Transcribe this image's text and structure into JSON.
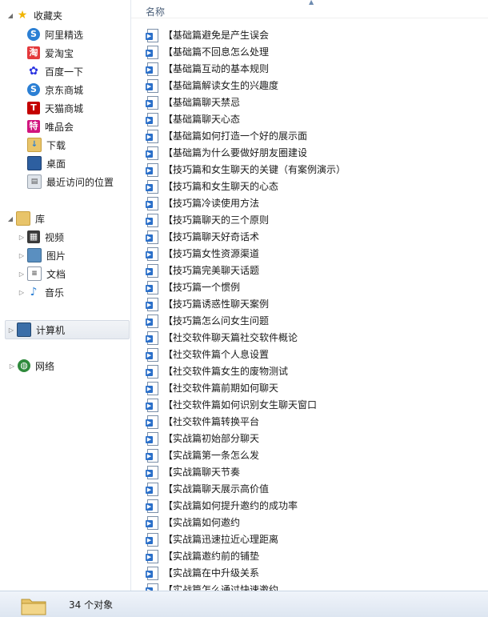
{
  "sidebar": {
    "favorites": {
      "label": "收藏夹",
      "items": [
        {
          "label": "阿里精选",
          "icon": "ali-icon"
        },
        {
          "label": "爱淘宝",
          "icon": "taobao-icon"
        },
        {
          "label": "百度一下",
          "icon": "baidu-icon"
        },
        {
          "label": "京东商城",
          "icon": "jd-icon"
        },
        {
          "label": "天猫商城",
          "icon": "tmall-icon"
        },
        {
          "label": "唯品会",
          "icon": "vip-icon"
        },
        {
          "label": "下载",
          "icon": "download-folder-icon"
        },
        {
          "label": "桌面",
          "icon": "desktop-icon"
        },
        {
          "label": "最近访问的位置",
          "icon": "recent-places-icon"
        }
      ]
    },
    "libraries": {
      "label": "库",
      "items": [
        {
          "label": "视频",
          "icon": "video-library-icon"
        },
        {
          "label": "图片",
          "icon": "pictures-library-icon"
        },
        {
          "label": "文档",
          "icon": "documents-library-icon"
        },
        {
          "label": "音乐",
          "icon": "music-library-icon"
        }
      ]
    },
    "computer": {
      "label": "计算机"
    },
    "network": {
      "label": "网络"
    }
  },
  "content": {
    "column_header": "名称",
    "files": [
      "【基础篇避免是产生误会",
      "【基础篇不回息怎么处理",
      "【基础篇互动的基本规则",
      "【基础篇解读女生的兴趣度",
      "【基础篇聊天禁忌",
      "【基础篇聊天心态",
      "【基础篇如何打造一个好的展示面",
      "【基础篇为什么要做好朋友圈建设",
      "【技巧篇和女生聊天的关键（有案例演示）",
      "【技巧篇和女生聊天的心态",
      "【技巧篇冷读使用方法",
      "【技巧篇聊天的三个原则",
      "【技巧篇聊天好奇话术",
      "【技巧篇女性资源渠道",
      "【技巧篇完美聊天话题",
      "【技巧篇一个惯例",
      "【技巧篇诱惑性聊天案例",
      "【技巧篇怎么问女生问题",
      "【社交软件聊天篇社交软件概论",
      "【社交软件篇个人息设置",
      "【社交软件篇女生的废物测试",
      "【社交软件篇前期如何聊天",
      "【社交软件篇如何识别女生聊天窗口",
      "【社交软件篇转换平台",
      "【实战篇初始部分聊天",
      "【实战篇第一条怎么发",
      "【实战篇聊天节奏",
      "【实战篇聊天展示高价值",
      "【实战篇如何提升邀约的成功率",
      "【实战篇如何邀约",
      "【实战篇迅速拉近心理距离",
      "【实战篇邀约前的铺垫",
      "【实战篇在中升级关系",
      "【实战篇怎么通过快速邀约"
    ]
  },
  "statusbar": {
    "text": "34 个对象"
  },
  "colors": {
    "accent": "#2a6fc9",
    "status_bg": "#dde6f1"
  }
}
